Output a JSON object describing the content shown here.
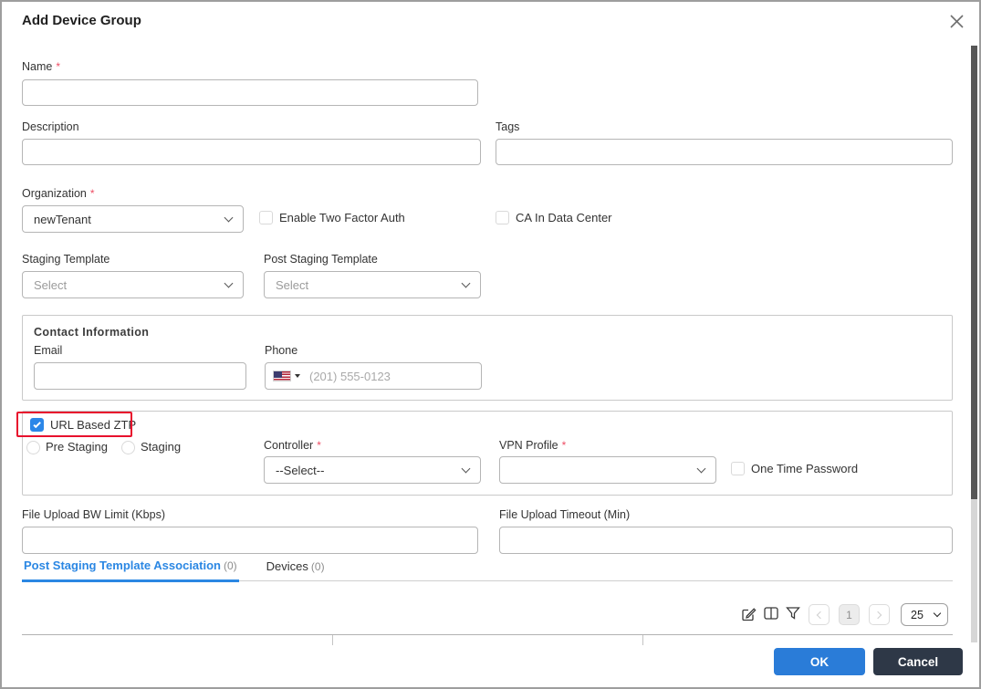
{
  "dialog": {
    "title": "Add Device Group"
  },
  "fields": {
    "name": {
      "label": "Name",
      "required": "*",
      "value": ""
    },
    "description": {
      "label": "Description",
      "value": ""
    },
    "tags": {
      "label": "Tags",
      "value": ""
    },
    "organization": {
      "label": "Organization",
      "required": "*",
      "value": "newTenant"
    },
    "enable_two_factor": {
      "label": "Enable Two Factor Auth",
      "checked": false
    },
    "ca_in_data_center": {
      "label": "CA In Data Center",
      "checked": false
    },
    "staging_template": {
      "label": "Staging Template",
      "placeholder": "Select"
    },
    "post_staging_template": {
      "label": "Post Staging Template",
      "placeholder": "Select"
    },
    "contact": {
      "title": "Contact Information",
      "email_label": "Email",
      "email_value": "",
      "phone_label": "Phone",
      "phone_placeholder": "(201) 555-0123",
      "phone_value": ""
    },
    "url_based_ztp": {
      "label": "URL Based ZTP",
      "checked": true,
      "annotated": true
    },
    "pre_staging": {
      "label": "Pre Staging",
      "selected": false
    },
    "staging": {
      "label": "Staging",
      "selected": false
    },
    "controller": {
      "label": "Controller",
      "required": "*",
      "value": "--Select--"
    },
    "vpn_profile": {
      "label": "VPN Profile",
      "required": "*",
      "value": ""
    },
    "one_time_password": {
      "label": "One Time Password",
      "checked": false
    },
    "bw_limit": {
      "label": "File Upload BW Limit (Kbps)",
      "value": ""
    },
    "upload_timeout": {
      "label": "File Upload Timeout (Min)",
      "value": ""
    }
  },
  "tabs": [
    {
      "label": "Post Staging Template Association",
      "count": "(0)",
      "active": true
    },
    {
      "label": "Devices",
      "count": "(0)",
      "active": false
    }
  ],
  "toolbar": {
    "icons": [
      "edit-icon",
      "columns-icon",
      "filter-icon"
    ],
    "page": "1",
    "page_size": "25"
  },
  "footer": {
    "ok": "OK",
    "cancel": "Cancel"
  },
  "colors": {
    "accent_blue": "#2b87e3",
    "checkbox_checked": "#2c87e8",
    "annotation_red": "#e8112d",
    "required_red": "#ee4d64",
    "ok_button": "#2a7cd8",
    "cancel_button": "#2e3847"
  }
}
